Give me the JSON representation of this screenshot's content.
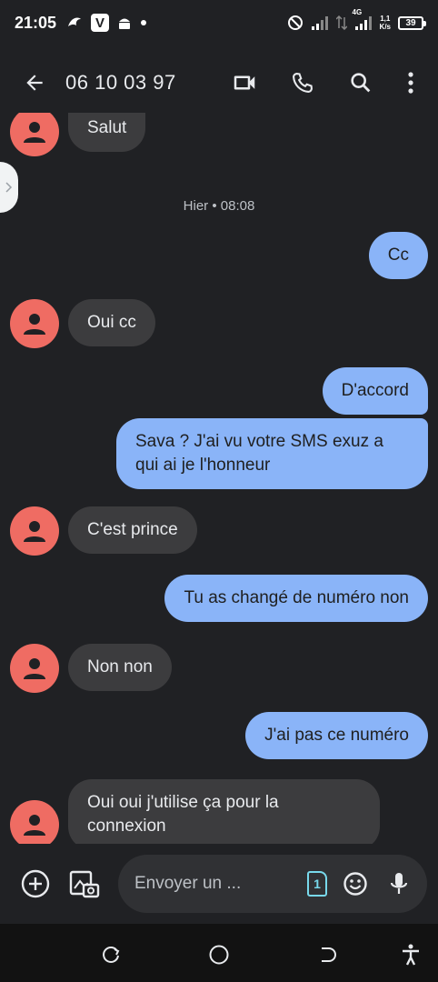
{
  "status_bar": {
    "time": "21:05",
    "network": "4G",
    "speed_value": "1,1",
    "speed_unit": "K/s",
    "battery": "39"
  },
  "header": {
    "title": "06 10 03 97",
    "icons": [
      "arrow-back-icon",
      "video-call-icon",
      "phone-icon",
      "search-icon",
      "more-vert-icon"
    ]
  },
  "conversation": {
    "date_label": "Hier • 08:08",
    "messages": [
      {
        "dir": "in",
        "text": "Salut"
      },
      {
        "dir": "out",
        "text": "Cc"
      },
      {
        "dir": "in",
        "text": "Oui cc"
      },
      {
        "dir": "out",
        "text": "D'accord"
      },
      {
        "dir": "out",
        "text": "Sava ? J'ai vu votre SMS exuz a qui ai je l'honneur"
      },
      {
        "dir": "in",
        "text": "C'est prince"
      },
      {
        "dir": "out",
        "text": "Tu as changé de numéro non"
      },
      {
        "dir": "in",
        "text": "Non non"
      },
      {
        "dir": "out",
        "text": "J'ai pas ce numéro"
      },
      {
        "dir": "in",
        "text": "Oui oui j'utilise ça pour la connexion"
      }
    ]
  },
  "compose": {
    "placeholder": "Envoyer un ...",
    "sim_number": "1"
  },
  "colors": {
    "background": "#202124",
    "incoming_bubble": "#3c3c3e",
    "outgoing_bubble": "#8ab4f8",
    "avatar": "#ef6c63",
    "sim_accent": "#78d9ec"
  }
}
